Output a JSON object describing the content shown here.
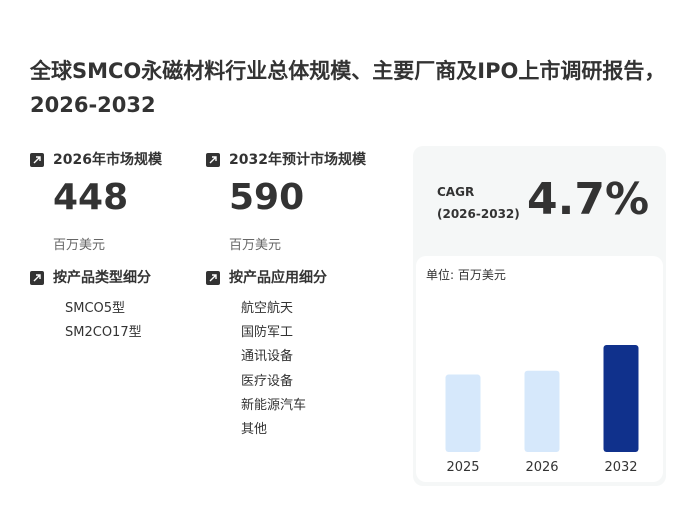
{
  "title": "全球SMCO永磁材料行业总体规模、主要厂商及IPO上市调研报告，2026-2032",
  "metrics": [
    {
      "label": "2026年市场规模",
      "value": "448",
      "unit": "百万美元"
    },
    {
      "label": "2032年预计市场规模",
      "value": "590",
      "unit": "百万美元"
    }
  ],
  "segments": {
    "by_type": {
      "label": "按产品类型细分",
      "items": [
        "SMCO5型",
        "SM2CO17型"
      ]
    },
    "by_application": {
      "label": "按产品应用细分",
      "items": [
        "航空航天",
        "国防军工",
        "通讯设备",
        "医疗设备",
        "新能源汽车",
        "其他"
      ]
    }
  },
  "cagr": {
    "label_line1": "CAGR",
    "label_line2": "(2026-2032)",
    "value": "4.7%"
  },
  "chart_data": {
    "type": "bar",
    "unit_label": "单位: 百万美元",
    "categories": [
      "2025",
      "2026",
      "2032"
    ],
    "values": [
      427,
      448,
      590
    ],
    "colors": [
      "#d6e8fb",
      "#d6e8fb",
      "#10318c"
    ]
  },
  "icons": {
    "metric": "arrow-up-right-icon"
  }
}
